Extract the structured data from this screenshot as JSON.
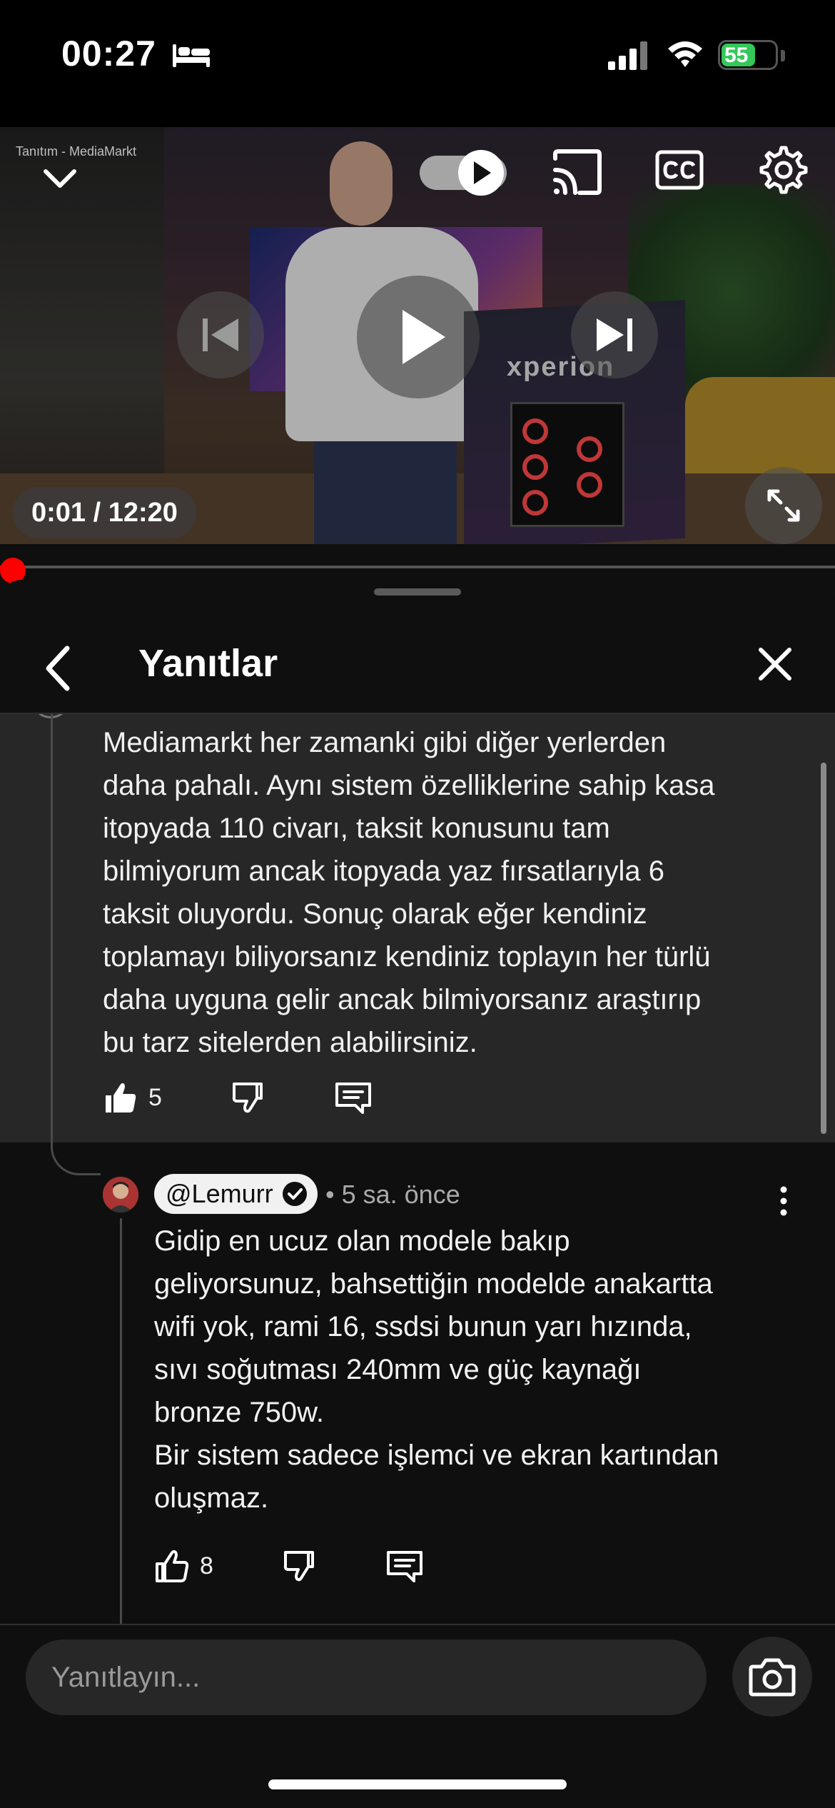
{
  "status_bar": {
    "time": "00:27",
    "battery": "55"
  },
  "video": {
    "ad_label": "Tanıtım - MediaMarkt",
    "box_text": "xperion",
    "time_display": "0:01 / 12:20",
    "progress_fraction": 0.001
  },
  "panel": {
    "title": "Yanıtlar"
  },
  "comments": [
    {
      "text": "Mediamarkt her zamanki gibi diğer yerlerden\ndaha pahalı. Aynı sistem özelliklerine sahip kasa\nitopyada 110 civarı, taksit konusunu tam\nbilmiyorum ancak itopyada yaz fırsatlarıyla 6\ntaksit oluyordu. Sonuç olarak eğer kendiniz\ntoplamayı biliyorsanız kendiniz toplayın her türlü\ndaha uyguna gelir ancak bilmiyorsanız araştırıp\nbu tarz sitelerden alabilirsiniz.",
      "likes": "5"
    },
    {
      "author": "@Lemurr",
      "meta": "• 5 sa. önce",
      "text": "Gidip en ucuz olan modele bakıp\ngeliyorsunuz, bahsettiğin modelde anakartta\nwifi yok, rami 16, ssdsi bunun yarı hızında,\nsıvı soğutması 240mm ve güç kaynağı\nbronze 750w.\nBir sistem sadece işlemci ve ekran kartından\noluşmaz.",
      "likes": "8"
    }
  ],
  "compose": {
    "placeholder": "Yanıtlayın..."
  },
  "colors": {
    "accent": "#ff0000",
    "highlight_bg": "#272727",
    "background": "#0f0f0f"
  }
}
